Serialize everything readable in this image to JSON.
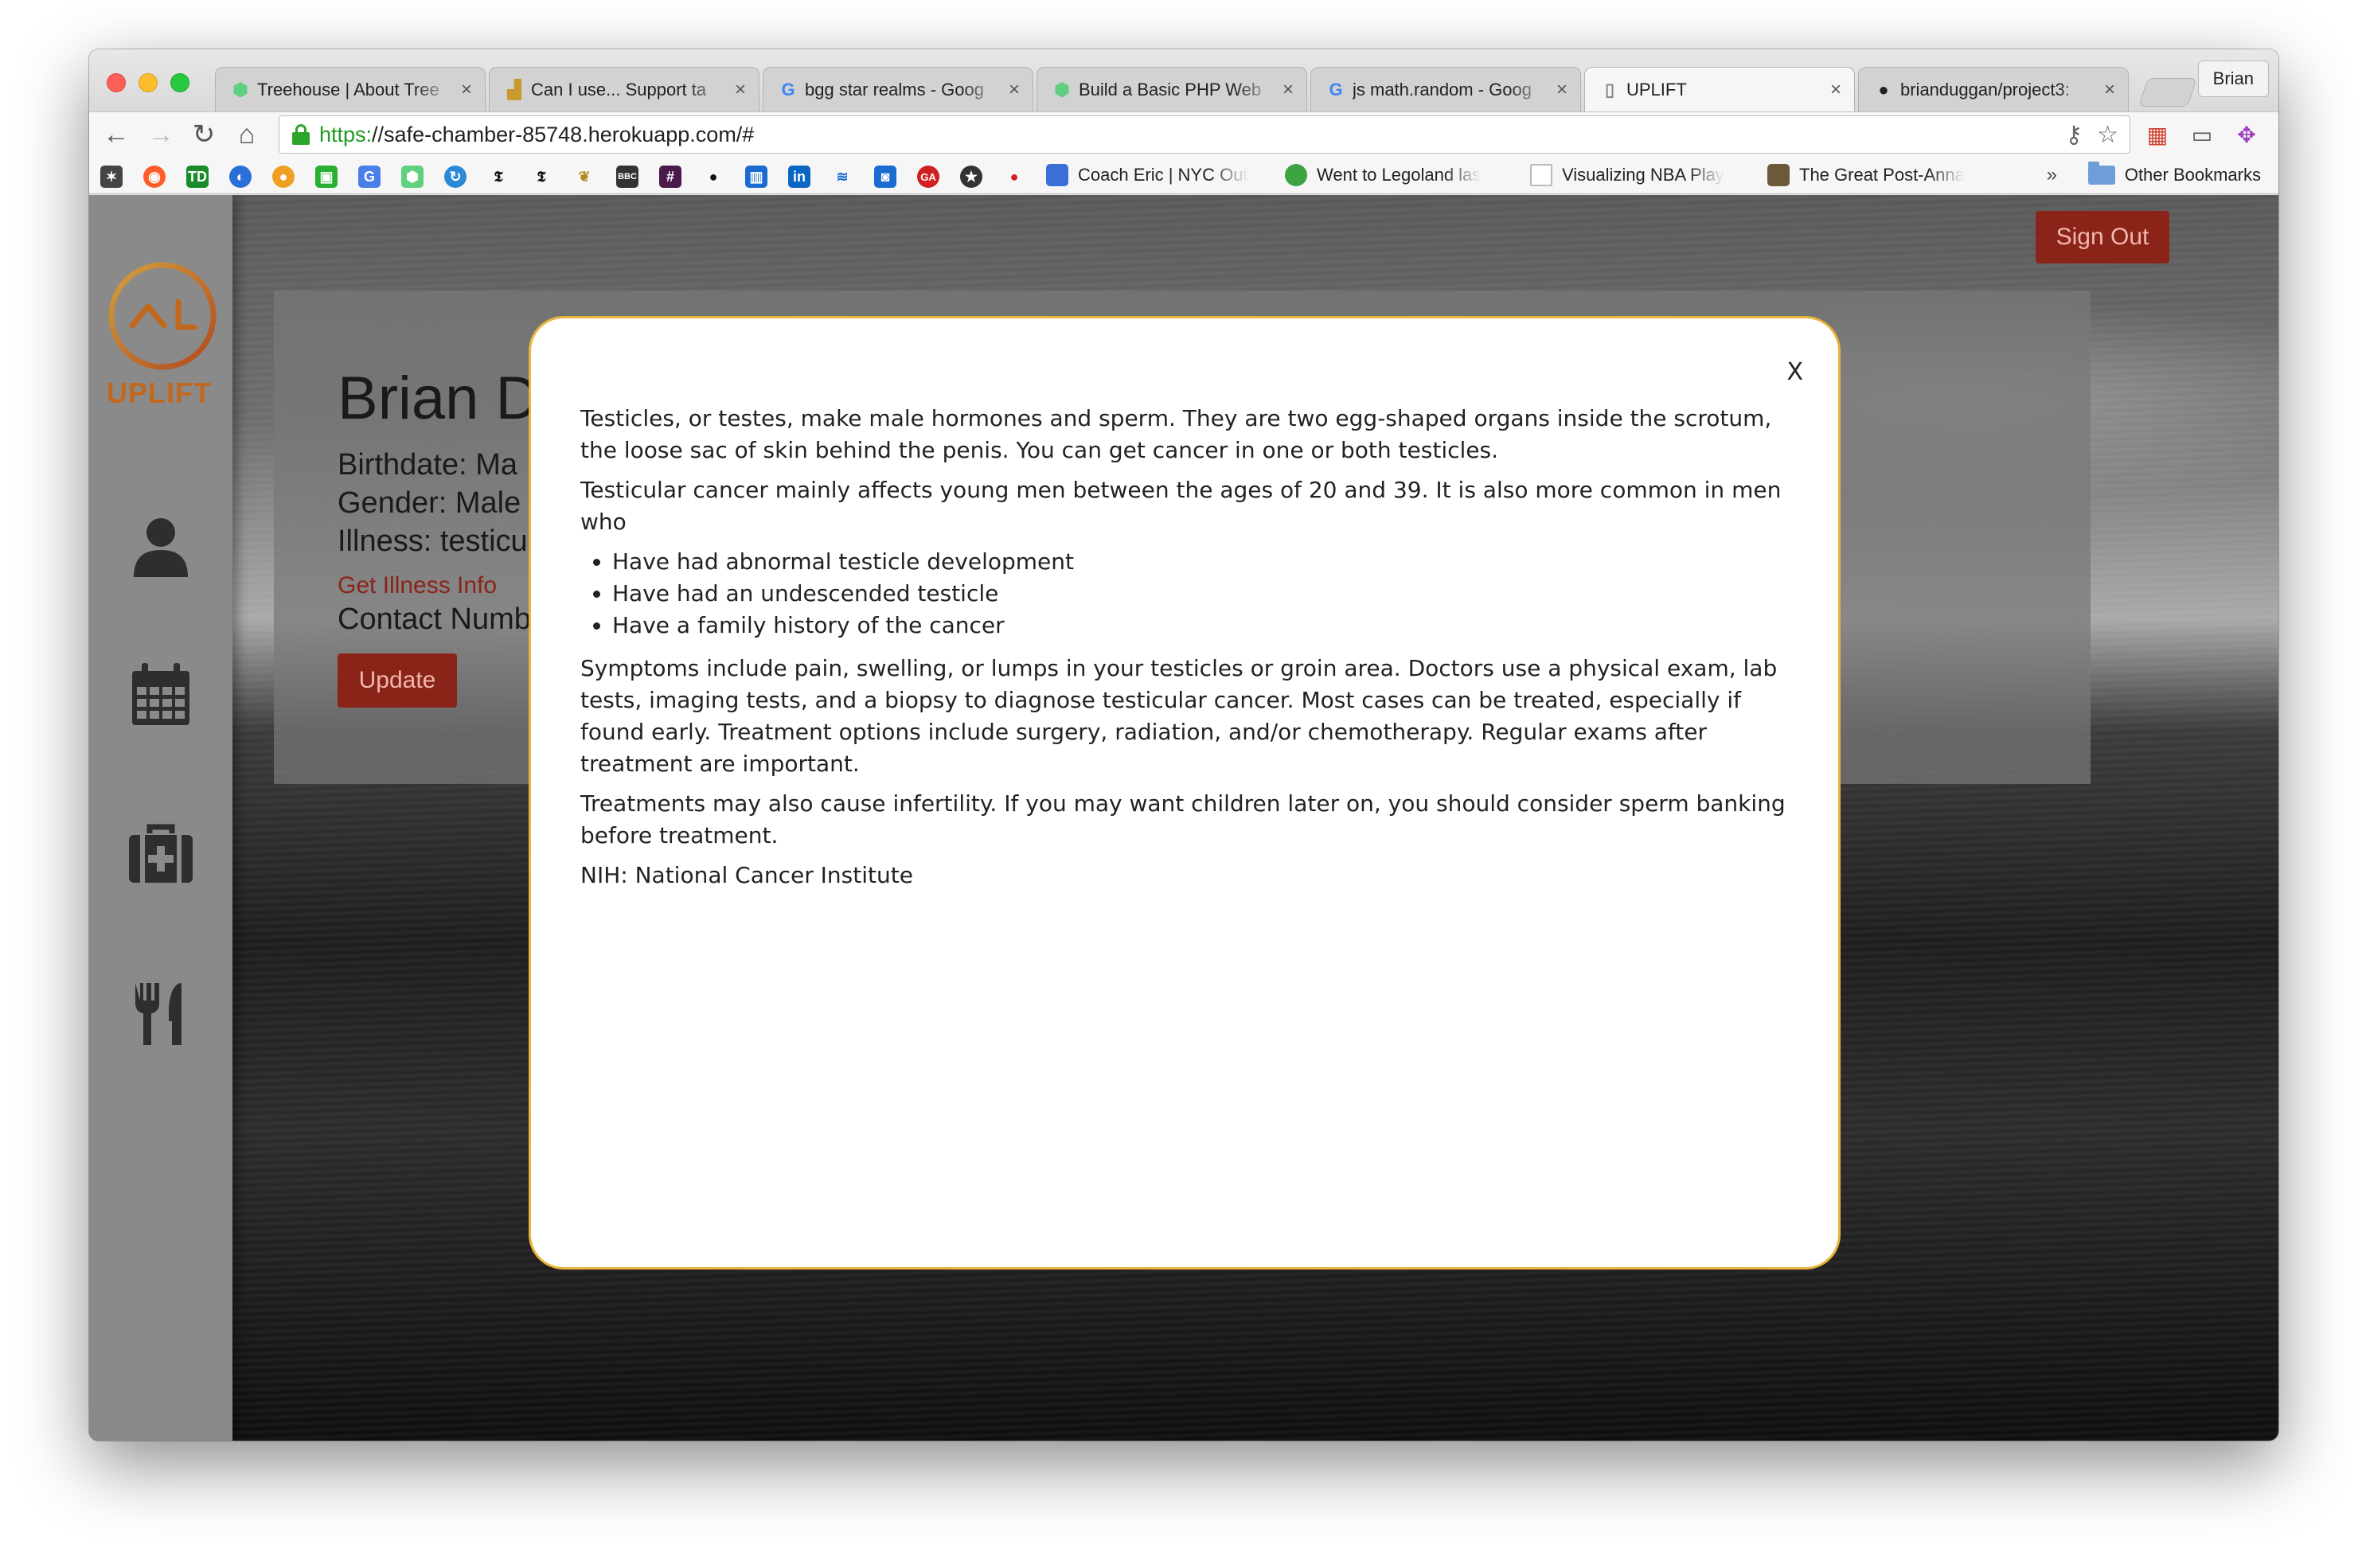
{
  "window": {
    "tabs": [
      {
        "title": "Treehouse | About Tree",
        "favicon_color": "#5fcf80"
      },
      {
        "title": "Can I use... Support ta",
        "favicon_color": "#c99a2e"
      },
      {
        "title": "bgg star realms - Goog",
        "favicon_color": "#4285f4"
      },
      {
        "title": "Build a Basic PHP Web",
        "favicon_color": "#5fcf80"
      },
      {
        "title": "js math.random - Goog",
        "favicon_color": "#4285f4"
      },
      {
        "title": "UPLIFT",
        "favicon_color": "#888888"
      },
      {
        "title": "brianduggan/project3:",
        "favicon_color": "#222222"
      }
    ],
    "profile_label": "Brian",
    "address": {
      "scheme": "https:",
      "rest": "//safe-chamber-85748.herokuapp.com/#"
    },
    "bookmarks": [
      {
        "title": "Coach Eric | NYC Out",
        "icon_color": "#3b6fd8"
      },
      {
        "title": "Went to Legoland las",
        "icon_color": "#3aa541"
      },
      {
        "title": "Visualizing NBA Play",
        "icon_color": "#cccccc"
      },
      {
        "title": "The Great Post-Anna",
        "icon_color": "#6b5a3a"
      }
    ],
    "bookmarks_more": "»",
    "other_bookmarks": "Other Bookmarks"
  },
  "app": {
    "brand": "UPLIFT",
    "sign_out": "Sign Out",
    "profile": {
      "name": "Brian D",
      "birthdate": "Birthdate: Ma",
      "gender": "Gender: Male",
      "illness": "Illness: testicu",
      "illness_link": "Get Illness Info",
      "contact": "Contact Numb",
      "update_button": "Update"
    }
  },
  "modal": {
    "close_label": "X",
    "paragraph1": "Testicles, or testes, make male hormones and sperm. They are two egg-shaped organs inside the scrotum, the loose sac of skin behind the penis. You can get cancer in one or both testicles.",
    "paragraph2": "Testicular cancer mainly affects young men between the ages of 20 and 39. It is also more common in men who",
    "risk_factors": [
      "Have had abnormal testicle development",
      "Have had an undescended testicle",
      "Have a family history of the cancer"
    ],
    "paragraph3": "Symptoms include pain, swelling, or lumps in your testicles or groin area. Doctors use a physical exam, lab tests, imaging tests, and a biopsy to diagnose testicular cancer. Most cases can be treated, especially if found early. Treatment options include surgery, radiation, and/or chemotherapy. Regular exams after treatment are important.",
    "paragraph4": "Treatments may also cause infertility. If you may want children later on, you should consider sperm banking before treatment.",
    "source": "NIH: National Cancer Institute"
  },
  "colors": {
    "accent": "#8a2419",
    "logo": "#c2681d",
    "modal_border": "#e8b43a"
  }
}
